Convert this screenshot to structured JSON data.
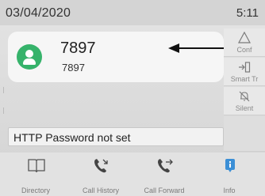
{
  "status": {
    "date": "03/04/2020",
    "time": "5:11"
  },
  "call": {
    "name": "7897",
    "number": "7897"
  },
  "softkeys": [
    {
      "label": "Conf",
      "icon": "conference-icon"
    },
    {
      "label": "Smart Tr",
      "icon": "smart-transfer-icon"
    },
    {
      "label": "Silent",
      "icon": "bell-muted-icon"
    },
    {
      "label": "",
      "icon": ""
    }
  ],
  "notice": "HTTP Password not set",
  "bottom_nav": [
    {
      "label": "Directory",
      "icon": "book-icon"
    },
    {
      "label": "Call History",
      "icon": "phone-history-icon"
    },
    {
      "label": "Call Forward",
      "icon": "phone-forward-icon"
    },
    {
      "label": "Info",
      "icon": "info-icon"
    }
  ],
  "colors": {
    "avatar": "#36b36b",
    "info_accent": "#3b8fd6"
  }
}
